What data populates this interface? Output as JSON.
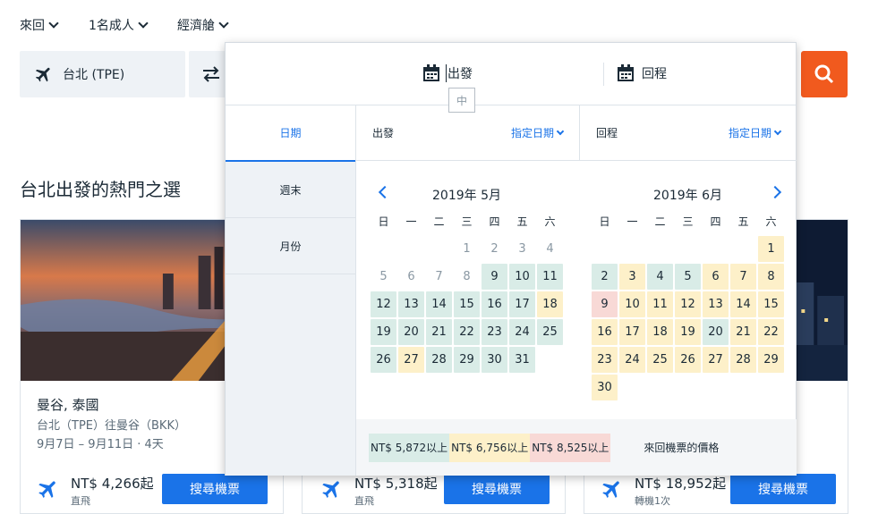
{
  "top": {
    "trip_type": "來回",
    "passengers": "1名成人",
    "cabin": "經濟艙"
  },
  "search": {
    "origin": "台北 (TPE)",
    "search_icon": "search-icon"
  },
  "section_title": "台北出發的熱門之選",
  "cards": [
    {
      "title": "曼谷, 泰國",
      "route": "台北（TPE）往曼谷（BKK）",
      "dates": "9月7日 – 9月11日 · 4天",
      "price": "NT$ 4,266起",
      "stops": "直飛",
      "button": "搜尋機票"
    },
    {
      "price": "NT$ 5,318起",
      "stops": "直飛",
      "button": "搜尋機票"
    },
    {
      "price": "NT$ 18,952起",
      "stops": "轉機1次",
      "button": "搜尋機票"
    }
  ],
  "panel": {
    "depart_tab": "出發",
    "ime_char": "中",
    "return_tab": "回程",
    "nav": [
      "日期",
      "週末",
      "月份"
    ],
    "depart_label": "出發",
    "depart_mode": "指定日期",
    "return_label": "回程",
    "return_mode": "指定日期",
    "weekdays": [
      "日",
      "一",
      "二",
      "三",
      "四",
      "五",
      "六"
    ],
    "months": [
      {
        "title": "2019年 5月",
        "lead": 3,
        "days": [
          [
            "1",
            "n"
          ],
          [
            "2",
            "n"
          ],
          [
            "3",
            "n"
          ],
          [
            "4",
            "n"
          ],
          [
            "5",
            "n"
          ],
          [
            "6",
            "n"
          ],
          [
            "7",
            "n"
          ],
          [
            "8",
            "n"
          ],
          [
            "9",
            "g"
          ],
          [
            "10",
            "g"
          ],
          [
            "11",
            "g"
          ],
          [
            "12",
            "g"
          ],
          [
            "13",
            "g"
          ],
          [
            "14",
            "g"
          ],
          [
            "15",
            "g"
          ],
          [
            "16",
            "g"
          ],
          [
            "17",
            "g"
          ],
          [
            "18",
            "y"
          ],
          [
            "19",
            "g"
          ],
          [
            "20",
            "g"
          ],
          [
            "21",
            "g"
          ],
          [
            "22",
            "g"
          ],
          [
            "23",
            "g"
          ],
          [
            "24",
            "g"
          ],
          [
            "25",
            "g"
          ],
          [
            "26",
            "g"
          ],
          [
            "27",
            "y"
          ],
          [
            "28",
            "g"
          ],
          [
            "29",
            "g"
          ],
          [
            "30",
            "g"
          ],
          [
            "31",
            "g"
          ]
        ]
      },
      {
        "title": "2019年 6月",
        "lead": 6,
        "days": [
          [
            "1",
            "y"
          ],
          [
            "2",
            "g"
          ],
          [
            "3",
            "y"
          ],
          [
            "4",
            "g"
          ],
          [
            "5",
            "g"
          ],
          [
            "6",
            "y"
          ],
          [
            "7",
            "y"
          ],
          [
            "8",
            "y"
          ],
          [
            "9",
            "r"
          ],
          [
            "10",
            "y"
          ],
          [
            "11",
            "y"
          ],
          [
            "12",
            "y"
          ],
          [
            "13",
            "y"
          ],
          [
            "14",
            "y"
          ],
          [
            "15",
            "y"
          ],
          [
            "16",
            "y"
          ],
          [
            "17",
            "y"
          ],
          [
            "18",
            "y"
          ],
          [
            "19",
            "y"
          ],
          [
            "20",
            "g"
          ],
          [
            "21",
            "y"
          ],
          [
            "22",
            "y"
          ],
          [
            "23",
            "y"
          ],
          [
            "24",
            "y"
          ],
          [
            "25",
            "y"
          ],
          [
            "26",
            "y"
          ],
          [
            "27",
            "y"
          ],
          [
            "28",
            "y"
          ],
          [
            "29",
            "y"
          ],
          [
            "30",
            "y"
          ]
        ]
      }
    ],
    "legend": {
      "low": "NT$ 5,872以上",
      "mid": "NT$ 6,756以上",
      "high": "NT$ 8,525以上",
      "caption": "來回機票的價格"
    },
    "colors": {
      "low": "#d9ece7",
      "mid": "#fdf0c9",
      "high": "#f8d9d6",
      "accent": "#1a73e8",
      "search": "#f15a1e"
    }
  }
}
